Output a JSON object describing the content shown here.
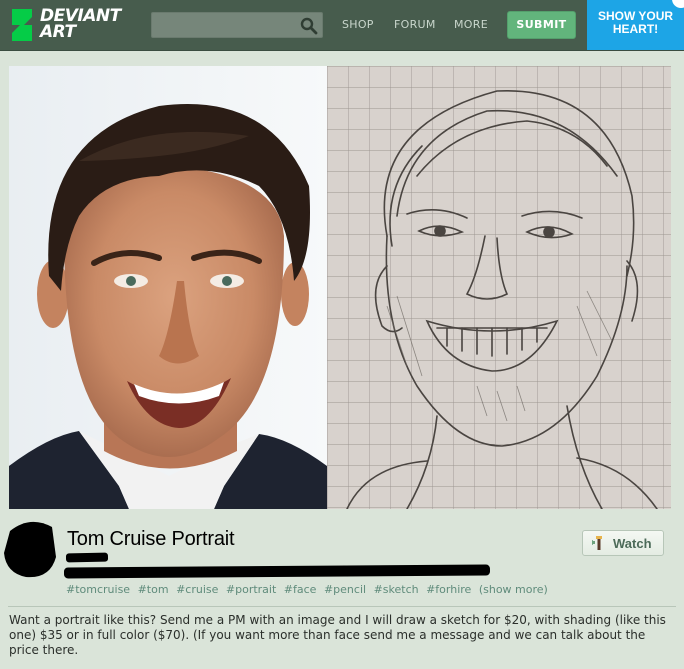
{
  "header": {
    "logo_line1": "DEVIANT",
    "logo_line2": "ART",
    "search": {
      "value": "",
      "placeholder": ""
    },
    "nav": [
      "SHOP",
      "FORUM",
      "MORE"
    ],
    "submit_label": "SUBMIT",
    "promo": {
      "line1": "SHOW YOUR",
      "line2": "HEART!"
    },
    "colors": {
      "bar": "#475c4d",
      "submit": "#62b57c",
      "promo": "#1da5e6"
    }
  },
  "artwork": {
    "left_image": "photo-portrait",
    "right_image": "pencil-sketch-on-grid-paper"
  },
  "deviation": {
    "title": "Tom Cruise Portrait",
    "watch_label": "Watch",
    "tags": [
      "#tomcruise",
      "#tom",
      "#cruise",
      "#portrait",
      "#face",
      "#pencil",
      "#sketch",
      "#forhire",
      "(show more)"
    ],
    "description": "Want a portrait like this? Send me a PM with an image and I will draw a sketch for $20, with shading (like this one) $35 or in full color ($70). (If you want more than face send me a message and we can talk about the price there."
  }
}
